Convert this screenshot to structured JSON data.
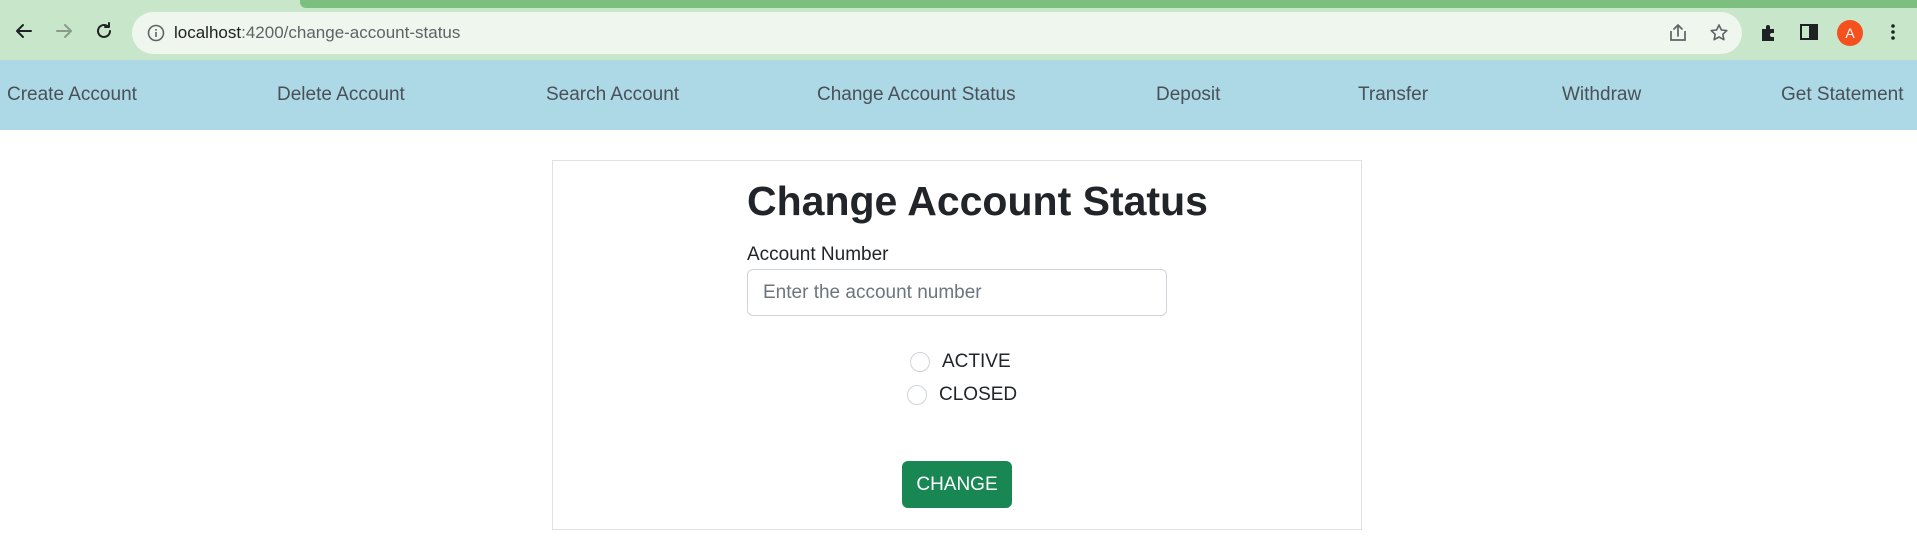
{
  "browser": {
    "url_host": "localhost",
    "url_path": ":4200/change-account-status",
    "avatar_letter": "A",
    "icons": [
      "back-arrow-icon",
      "forward-arrow-icon",
      "reload-icon",
      "info-icon",
      "share-icon",
      "star-icon",
      "extensions-icon",
      "side-panel-icon",
      "kebab-menu-icon"
    ]
  },
  "nav": {
    "items": [
      {
        "label": "Create Account"
      },
      {
        "label": "Delete Account"
      },
      {
        "label": "Search Account"
      },
      {
        "label": "Change Account Status"
      },
      {
        "label": "Deposit"
      },
      {
        "label": "Transfer"
      },
      {
        "label": "Withdraw"
      },
      {
        "label": "Get Statement"
      }
    ]
  },
  "form": {
    "title": "Change Account Status",
    "account_label": "Account Number",
    "account_placeholder": "Enter the account number",
    "account_value": "",
    "status_options": [
      {
        "label": "ACTIVE",
        "checked": false
      },
      {
        "label": "CLOSED",
        "checked": false
      }
    ],
    "submit_label": "CHANGE"
  },
  "colors": {
    "nav_bg": "#add8e6",
    "button_bg": "#198754",
    "chrome_bg": "#c8e6c9",
    "avatar_bg": "#f4511e"
  }
}
